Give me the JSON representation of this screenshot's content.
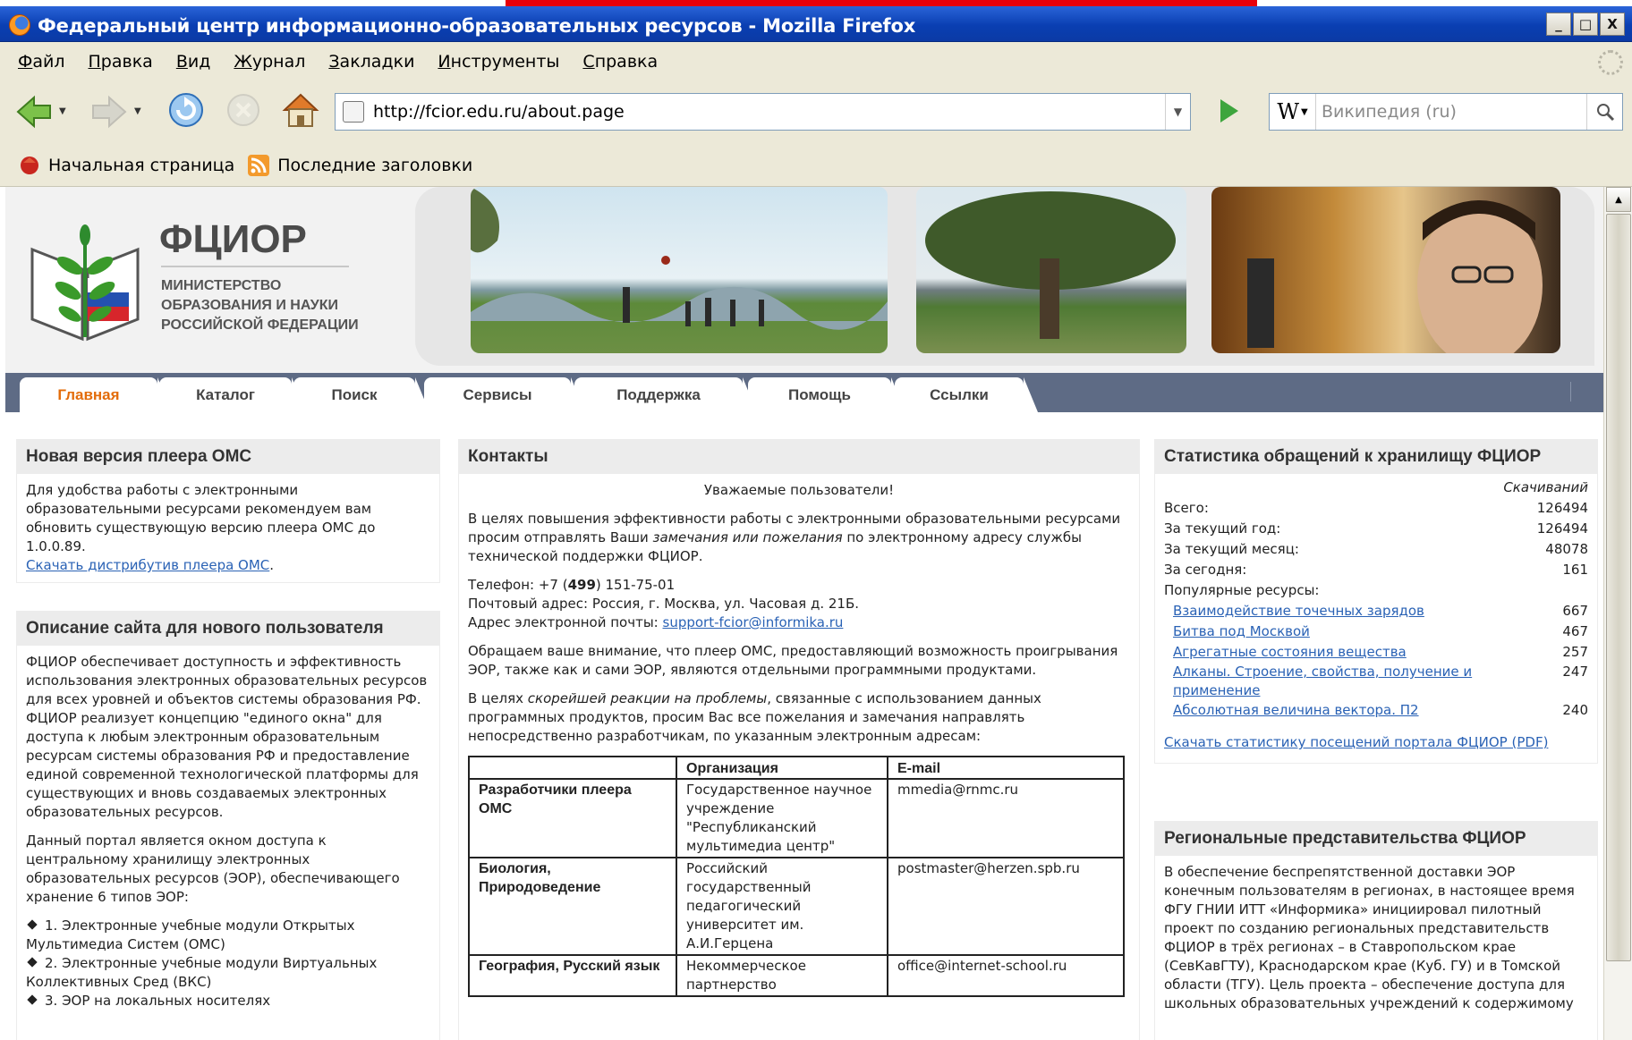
{
  "window": {
    "title": "Федеральный центр информационно-образовательных ресурсов - Mozilla Firefox",
    "min": "_",
    "max": "□",
    "close": "X"
  },
  "menu": {
    "items": [
      {
        "first": "Ф",
        "rest": "айл"
      },
      {
        "first": "П",
        "rest": "равка"
      },
      {
        "first": "В",
        "rest": "ид"
      },
      {
        "first": "Ж",
        "rest": "урнал"
      },
      {
        "first": "З",
        "rest": "акладки"
      },
      {
        "first": "И",
        "rest": "нструменты"
      },
      {
        "first": "С",
        "rest": "правка"
      }
    ]
  },
  "toolbar": {
    "url": "http://fcior.edu.ru/about.page",
    "search_engine": "W",
    "search_placeholder": "Википедия (ru)"
  },
  "bookmarks": [
    {
      "label": "Начальная страница"
    },
    {
      "label": "Последние заголовки"
    }
  ],
  "header": {
    "title": "ФЦИОР",
    "sub1": "МИНИСТЕРСТВО",
    "sub2": "ОБРАЗОВАНИЯ И НАУКИ",
    "sub3": "РОССИЙСКОЙ ФЕДЕРАЦИИ"
  },
  "tabs": [
    "Главная",
    "Каталог",
    "Поиск",
    "Сервисы",
    "Поддержка",
    "Помощь",
    "Ссылки"
  ],
  "left": {
    "box1": {
      "title": "Новая версия плеера ОМС",
      "text": "Для удобства работы с электронными образовательными ресурсами рекомендуем вам обновить существующую версию плеера ОМС до 1.0.0.89.",
      "link": "Скачать дистрибутив плеера ОМС",
      "after_link": "."
    },
    "box2": {
      "title": "Описание сайта для нового пользователя",
      "p1": "ФЦИОР обеспечивает доступность и эффективность использования электронных образовательных ресурсов для всех уровней и объектов системы образования РФ. ФЦИОР реализует концепцию \"единого окна\" для доступа к любым электронным образовательным ресурсам системы образования РФ и предоставление единой современной технологической платформы для существующих и вновь создаваемых электронных образовательных ресурсов.",
      "p2": "Данный портал является окном доступа к центральному хранилищу электронных образовательных ресурсов (ЭОР), обеспечивающего хранение 6 типов ЭОР:",
      "bullets": [
        "1. Электронные учебные модули Открытых Мультимедиа Систем (ОМС)",
        "2. Электронные учебные модули Виртуальных Коллективных Сред (ВКС)",
        "3. ЭОР на локальных носителях"
      ]
    }
  },
  "center": {
    "title": "Контакты",
    "greeting": "Уважаемые пользователи!",
    "p1_a": "В целях повышения эффективности работы с электронными образовательными ресурсами просим отправлять Ваши ",
    "p1_i": "замечания или пожелания",
    "p1_b": " по электронному адресу службы технической поддержки ФЦИОР.",
    "phone_label": "Телефон: +7 (",
    "phone_code": "499",
    "phone_rest": ") 151-75-01",
    "address": "Почтовый адрес: Россия, г. Москва, ул. Часовая д. 21Б.",
    "email_label": "Адрес электронной почты: ",
    "email": "support-fcior@informika.ru",
    "p3": "Обращаем ваше внимание, что плеер ОМС, предоставляющий возможность проигрывания ЭОР, также как и сами ЭОР, являются отдельными программными продуктами.",
    "p4_a": "В целях ",
    "p4_i": "скорейшей реакции на проблемы",
    "p4_b": ", связанные с использованием данных программных продуктов, просим Вас все пожелания и замечания направлять непосредственно разработчикам, по указанным электронным адресам:",
    "table": {
      "headers": [
        "",
        "Организация",
        "E-mail"
      ],
      "rows": [
        {
          "who": "Разработчики плеера ОМС",
          "org": "Государственное научное учреждение \"Республиканский мультимедиа центр\"",
          "email": "mmedia@rnmc.ru"
        },
        {
          "who": "Биология, Природоведение",
          "org": "Российский государственный педагогический университет им. А.И.Герцена",
          "email": "postmaster@herzen.spb.ru"
        },
        {
          "who": "География, Русский язык",
          "org": "Некоммерческое партнерство",
          "email": "office@internet-school.ru"
        }
      ]
    }
  },
  "right": {
    "stats": {
      "title": "Статистика обращений к хранилищу ФЦИОР",
      "col_header": "Скачиваний",
      "rows": [
        {
          "label": "Всего:",
          "value": "126494"
        },
        {
          "label": "За текущий год:",
          "value": "126494"
        },
        {
          "label": "За текущий месяц:",
          "value": "48078"
        },
        {
          "label": "За сегодня:",
          "value": "161"
        }
      ],
      "popular_label": "Популярные ресурсы:",
      "popular": [
        {
          "label": "Взаимодействие точечных зарядов",
          "value": "667"
        },
        {
          "label": "Битва под Москвой",
          "value": "467"
        },
        {
          "label": "Агрегатные состояния вещества",
          "value": "257"
        },
        {
          "label": "Алканы. Строение, свойства, получение и применение",
          "value": "247"
        },
        {
          "label": "Абсолютная величина вектора. П2",
          "value": "240"
        }
      ],
      "download_link": "Скачать статистику посещений портала ФЦИОР (PDF)"
    },
    "regional": {
      "title": "Региональные представительства ФЦИОР",
      "text": "В обеспечение беспрепятственной доставки ЭОР конечным пользователям в регионах, в настоящее время ФГУ ГНИИ ИТТ «Информика» инициировал пилотный проект по созданию региональных представительств ФЦИОР в трёх регионах – в Ставропольском крае (СевКавГТУ), Краснодарском крае (Куб. ГУ) и в Томской области (ТГУ). Цель проекта – обеспечение доступа для школьных образовательных учреждений к содержимому"
    }
  }
}
